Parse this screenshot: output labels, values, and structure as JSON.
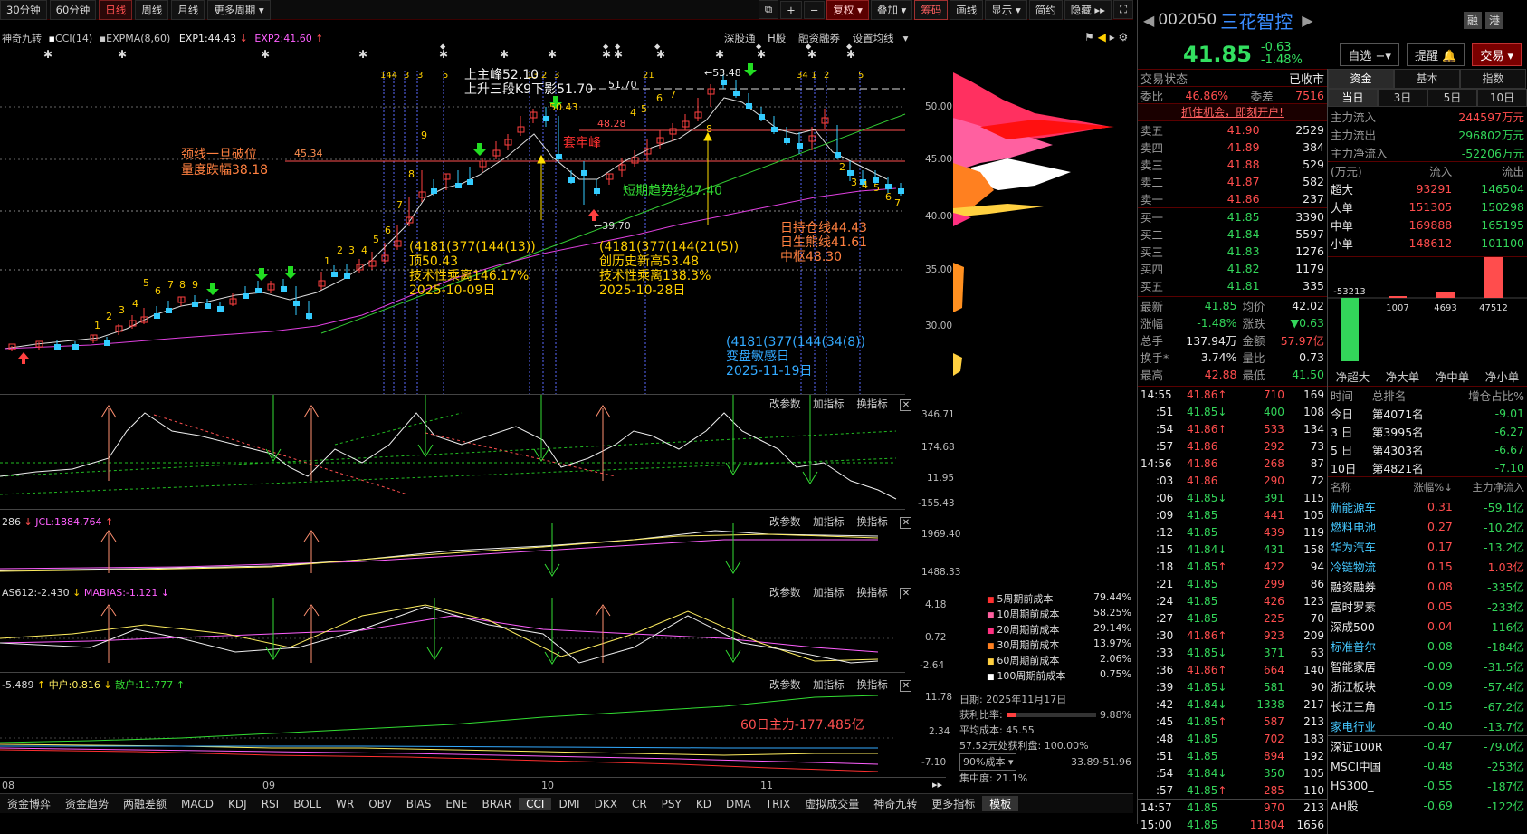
{
  "toolbar": {
    "periods": [
      "30分钟",
      "60分钟",
      "日线",
      "周线",
      "月线",
      "更多周期"
    ],
    "active_period": "日线",
    "tools": [
      "复权",
      "叠加",
      "筹码",
      "画线",
      "显示",
      "简约",
      "隐藏"
    ]
  },
  "chart_header": {
    "indicator": "神奇九转",
    "cci": "CCI(14)",
    "expma": "EXPMA(8,60)",
    "exp1": "EXP1:44.43",
    "exp2": "EXP2:41.60",
    "links": [
      "深股通",
      "H股",
      "融资融券",
      "设置均线"
    ]
  },
  "price_axis": [
    "50.00",
    "45.00",
    "40.00",
    "35.00",
    "30.00"
  ],
  "annotations": {
    "peak": "上主峰52.10",
    "stage3": "上升三段K9下影51.70",
    "stage3_val": "51.70",
    "neckline": "颈线一旦破位",
    "drop": "量度跌幅38.18",
    "neck_val": "45.34",
    "trap": "套牢峰",
    "trap_val": "48.28",
    "trend": "短期趋势线47.40",
    "hi_val": "53.48",
    "lo_val": "39.70",
    "box1": [
      "(4181(377(144(13))",
      "顶50.43",
      "技术性乘离146.17%",
      "2025-10-09日"
    ],
    "box2": [
      "(4181(377(144(21(5))",
      "创历史新高53.48",
      "技术性乘离138.3%",
      "2025-10-28日"
    ],
    "box3": [
      "日持仓线44.43",
      "日生熊线41.61",
      "中枢48.30"
    ],
    "box4": [
      "(4181(377(144(34(8))",
      "变盘敏感日",
      "2025-11-19日"
    ],
    "peak_mark": "50.43"
  },
  "panels": {
    "buttons": [
      "改参数",
      "加指标",
      "换指标"
    ],
    "cci_axis": [
      "346.71",
      "174.68",
      "11.95",
      "-155.43"
    ],
    "p2_label1": "286",
    "p2_label2": "JCL:1884.764",
    "p2_axis": [
      "1969.40",
      "1488.33"
    ],
    "p3_label1": "AS612:-2.430",
    "p3_label2": "MABIAS:-1.121",
    "p3_axis": [
      "4.18",
      "0.72",
      "-2.64"
    ],
    "p4_label1": "-5.489",
    "p4_label2": "中户:0.816",
    "p4_label3": "散户:11.777",
    "p4_axis": [
      "11.78",
      "2.34",
      "-7.10"
    ],
    "p4_note": "60日主力-177.485亿"
  },
  "cost_legend": [
    {
      "label": "5周期前成本",
      "value": "79.44%",
      "color": "#ff3030"
    },
    {
      "label": "10周期前成本",
      "value": "58.25%",
      "color": "#ff60a0"
    },
    {
      "label": "20周期前成本",
      "value": "29.14%",
      "color": "#ff3080"
    },
    {
      "label": "30周期前成本",
      "value": "13.97%",
      "color": "#ff8020"
    },
    {
      "label": "60周期前成本",
      "value": "2.06%",
      "color": "#ffd040"
    },
    {
      "label": "100周期前成本",
      "value": "0.75%",
      "color": "#ffffff"
    }
  ],
  "cost_info": {
    "date": "日期: 2025年11月17日",
    "profit_label": "获利比率:",
    "profit": "9.88%",
    "avg": "平均成本: 45.55",
    "range_profit": "57.52元处获利盘: 100.00%",
    "cost_sel": "90%成本",
    "range": "33.89-51.96",
    "conc": "集中度: 21.1%"
  },
  "x_axis": [
    "08",
    "09",
    "10",
    "11"
  ],
  "bottom_tabs": [
    "资金博弈",
    "资金趋势",
    "两融差额",
    "MACD",
    "KDJ",
    "RSI",
    "BOLL",
    "WR",
    "OBV",
    "BIAS",
    "ENE",
    "BRAR",
    "CCI",
    "DMI",
    "DKX",
    "CR",
    "PSY",
    "KD",
    "DMA",
    "TRIX",
    "虚拟成交量",
    "神奇九转",
    "更多指标",
    "模板"
  ],
  "bottom_active": "CCI",
  "stock": {
    "code": "002050",
    "name": "三花智控",
    "badges": [
      "融",
      "港"
    ],
    "price": "41.85",
    "change": "-0.63",
    "pct": "-1.48%",
    "btn_watch": "自选",
    "btn_alert": "提醒",
    "btn_trade": "交易",
    "trade_state_label": "交易状态",
    "trade_state": "已收市",
    "ratio_label": "委比",
    "ratio": "46.86%",
    "diff_label": "委差",
    "diff": "7516",
    "promo": "抓住机会，即刻开户!"
  },
  "orderbook": {
    "asks": [
      [
        "卖五",
        "41.90",
        "2529"
      ],
      [
        "卖四",
        "41.89",
        "384"
      ],
      [
        "卖三",
        "41.88",
        "529"
      ],
      [
        "卖二",
        "41.87",
        "582"
      ],
      [
        "卖一",
        "41.86",
        "237"
      ]
    ],
    "bids": [
      [
        "买一",
        "41.85",
        "3390"
      ],
      [
        "买二",
        "41.84",
        "5597"
      ],
      [
        "买三",
        "41.83",
        "1276"
      ],
      [
        "买四",
        "41.82",
        "1179"
      ],
      [
        "买五",
        "41.81",
        "335"
      ]
    ]
  },
  "quote": [
    [
      "最新",
      "41.85",
      "均价",
      "42.02"
    ],
    [
      "涨幅",
      "-1.48%",
      "涨跌",
      "▼0.63"
    ],
    [
      "总手",
      "137.94万",
      "金额",
      "57.97亿"
    ],
    [
      "换手*",
      "3.74%",
      "量比",
      "0.73"
    ],
    [
      "最高",
      "42.88",
      "最低",
      "41.50"
    ]
  ],
  "ticks": [
    [
      "14:55",
      "41.86",
      "↑",
      "710",
      "169"
    ],
    [
      ":51",
      "41.85",
      "↓",
      "400",
      "108"
    ],
    [
      ":54",
      "41.86",
      "↑",
      "533",
      "134"
    ],
    [
      ":57",
      "41.86",
      "",
      "292",
      "73"
    ],
    [
      "14:56",
      "41.86",
      "",
      "268",
      "87"
    ],
    [
      ":03",
      "41.86",
      "",
      "290",
      "72"
    ],
    [
      ":06",
      "41.85",
      "↓",
      "391",
      "115"
    ],
    [
      ":09",
      "41.85",
      "",
      "441",
      "105"
    ],
    [
      ":12",
      "41.85",
      "",
      "439",
      "119"
    ],
    [
      ":15",
      "41.84",
      "↓",
      "431",
      "158"
    ],
    [
      ":18",
      "41.85",
      "↑",
      "422",
      "94"
    ],
    [
      ":21",
      "41.85",
      "",
      "299",
      "86"
    ],
    [
      ":24",
      "41.85",
      "",
      "426",
      "123"
    ],
    [
      ":27",
      "41.85",
      "",
      "225",
      "70"
    ],
    [
      ":30",
      "41.86",
      "↑",
      "923",
      "209"
    ],
    [
      ":33",
      "41.85",
      "↓",
      "371",
      "63"
    ],
    [
      ":36",
      "41.86",
      "↑",
      "664",
      "140"
    ],
    [
      ":39",
      "41.85",
      "↓",
      "581",
      "90"
    ],
    [
      ":42",
      "41.84",
      "↓",
      "1338",
      "217"
    ],
    [
      ":45",
      "41.85",
      "↑",
      "587",
      "213"
    ],
    [
      ":48",
      "41.85",
      "",
      "702",
      "183"
    ],
    [
      ":51",
      "41.85",
      "",
      "894",
      "192"
    ],
    [
      ":54",
      "41.84",
      "↓",
      "350",
      "105"
    ],
    [
      ":57",
      "41.85",
      "↑",
      "285",
      "110"
    ],
    [
      "14:57",
      "41.85",
      "",
      "970",
      "213"
    ],
    [
      "15:00",
      "41.85",
      "",
      "11804",
      "1656"
    ]
  ],
  "fund": {
    "tabs": [
      "资金",
      "基本",
      "指数"
    ],
    "periods": [
      "当日",
      "3日",
      "5日",
      "10日"
    ],
    "main_in_label": "主力流入",
    "main_in": "244597万元",
    "main_out_label": "主力流出",
    "main_out": "296802万元",
    "main_net_label": "主力净流入",
    "main_net": "-52206万元",
    "unit": "(万元)",
    "in_h": "流入",
    "out_h": "流出",
    "rows": [
      [
        "超大",
        "93291",
        "146504"
      ],
      [
        "大单",
        "151305",
        "150298"
      ],
      [
        "中单",
        "169888",
        "165195"
      ],
      [
        "小单",
        "148612",
        "101100"
      ]
    ],
    "bars": [
      {
        "label": "净超大",
        "value": -53213
      },
      {
        "label": "净大单",
        "value": 1007
      },
      {
        "label": "净中单",
        "value": 4693
      },
      {
        "label": "净小单",
        "value": 47512
      }
    ],
    "bar_labels": [
      "-53213",
      "1007",
      "4693",
      "47512"
    ]
  },
  "rank": {
    "headers": [
      "时间",
      "总排名",
      "增仓占比%"
    ],
    "rows": [
      [
        "今日",
        "第4071名",
        "-9.01"
      ],
      [
        "3 日",
        "第3995名",
        "-6.27"
      ],
      [
        "5 日",
        "第4303名",
        "-6.67"
      ],
      [
        "10日",
        "第4821名",
        "-7.10"
      ]
    ]
  },
  "sectors": {
    "headers": [
      "名称",
      "涨幅%↓",
      "主力净流入"
    ],
    "rows": [
      [
        "新能源车",
        "0.31",
        "-59.1亿",
        "cyan"
      ],
      [
        "燃料电池",
        "0.27",
        "-10.2亿",
        "cyan"
      ],
      [
        "华为汽车",
        "0.17",
        "-13.2亿",
        "cyan"
      ],
      [
        "冷链物流",
        "0.15",
        "1.03亿",
        "cyan"
      ],
      [
        "融资融券",
        "0.08",
        "-335亿",
        "white"
      ],
      [
        "富时罗素",
        "0.05",
        "-233亿",
        "white"
      ],
      [
        "深成500",
        "0.04",
        "-116亿",
        "white"
      ],
      [
        "标准普尔",
        "-0.08",
        "-184亿",
        "cyan"
      ],
      [
        "智能家居",
        "-0.09",
        "-31.5亿",
        "white"
      ],
      [
        "浙江板块",
        "-0.09",
        "-57.4亿",
        "white"
      ],
      [
        "长江三角",
        "-0.15",
        "-67.2亿",
        "white"
      ],
      [
        "家电行业",
        "-0.40",
        "-13.7亿",
        "cyan"
      ],
      [
        "深证100R",
        "-0.47",
        "-79.0亿",
        "white"
      ],
      [
        "MSCI中国",
        "-0.48",
        "-253亿",
        "white"
      ],
      [
        "HS300_",
        "-0.55",
        "-187亿",
        "white"
      ],
      [
        "AH股",
        "-0.69",
        "-122亿",
        "white"
      ]
    ]
  }
}
